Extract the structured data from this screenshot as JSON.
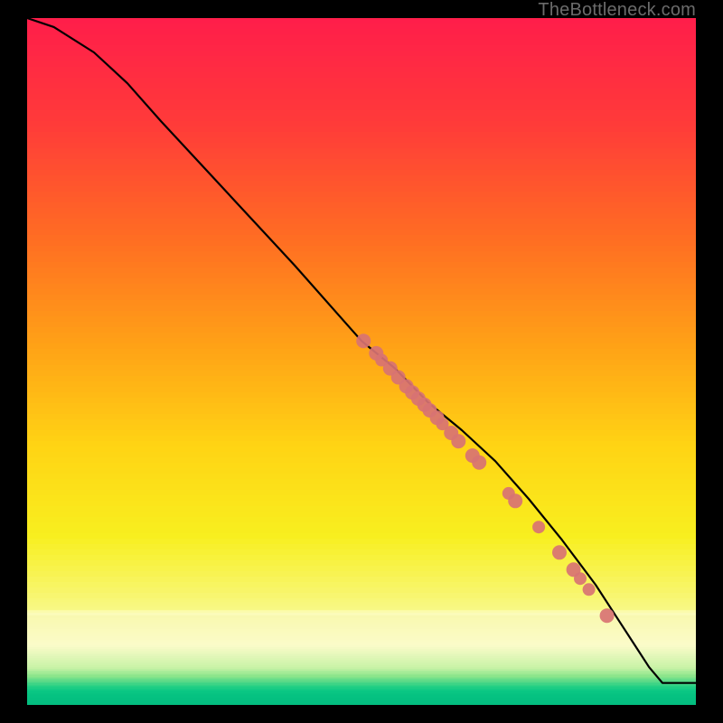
{
  "watermark": "TheBottleneck.com",
  "gradient_plan": {
    "comment": "vertical position (0..1 from top) → color, rendered as stacked horizontal strips",
    "stops": [
      {
        "at": 0.0,
        "color": "#FF1E4A"
      },
      {
        "at": 0.15,
        "color": "#FF3B39"
      },
      {
        "at": 0.32,
        "color": "#FF6E22"
      },
      {
        "at": 0.48,
        "color": "#FFA416"
      },
      {
        "at": 0.62,
        "color": "#FFD414"
      },
      {
        "at": 0.75,
        "color": "#F8EF1F"
      },
      {
        "at": 0.862,
        "color": "#F8F887"
      },
      {
        "at": 0.865,
        "color": "#F8F8AD"
      },
      {
        "at": 0.912,
        "color": "#FBFBC9"
      },
      {
        "at": 0.945,
        "color": "#C7F2A6"
      },
      {
        "at": 0.957,
        "color": "#8BE58B"
      },
      {
        "at": 0.965,
        "color": "#57D988"
      },
      {
        "at": 0.972,
        "color": "#25D084"
      },
      {
        "at": 0.978,
        "color": "#0CC884"
      },
      {
        "at": 0.985,
        "color": "#05C281"
      },
      {
        "at": 1.0,
        "color": "#03BC7F"
      }
    ],
    "narrow_band_effect": true
  },
  "chart_data": {
    "type": "line",
    "title": "",
    "xlabel": "",
    "ylabel": "",
    "xlim": [
      0,
      100
    ],
    "ylim": [
      0,
      100
    ],
    "series": [
      {
        "name": "main-curve",
        "x": [
          0,
          4,
          10,
          15,
          20,
          30,
          40,
          50,
          55,
          60,
          65,
          70,
          75,
          80,
          85,
          88,
          91,
          93,
          95,
          100
        ],
        "y": [
          100,
          98.7,
          95,
          90.5,
          85,
          74.5,
          64,
          53,
          49,
          44,
          40,
          35.5,
          30,
          24,
          17.5,
          13,
          8.5,
          5.5,
          3.2,
          3.2
        ]
      }
    ],
    "scatter": {
      "name": "highlight-points",
      "color": "#D87373",
      "points": [
        {
          "x": 50.3,
          "y": 53.0,
          "r": 8
        },
        {
          "x": 52.2,
          "y": 51.2,
          "r": 8
        },
        {
          "x": 53.0,
          "y": 50.2,
          "r": 7
        },
        {
          "x": 54.3,
          "y": 49.0,
          "r": 8
        },
        {
          "x": 55.5,
          "y": 47.7,
          "r": 8
        },
        {
          "x": 56.7,
          "y": 46.4,
          "r": 8
        },
        {
          "x": 57.6,
          "y": 45.5,
          "r": 8
        },
        {
          "x": 58.5,
          "y": 44.6,
          "r": 8
        },
        {
          "x": 59.4,
          "y": 43.7,
          "r": 8
        },
        {
          "x": 60.2,
          "y": 42.9,
          "r": 8
        },
        {
          "x": 61.3,
          "y": 41.8,
          "r": 8
        },
        {
          "x": 62.1,
          "y": 40.9,
          "r": 7
        },
        {
          "x": 63.4,
          "y": 39.6,
          "r": 8
        },
        {
          "x": 64.5,
          "y": 38.4,
          "r": 8
        },
        {
          "x": 66.6,
          "y": 36.3,
          "r": 8
        },
        {
          "x": 67.6,
          "y": 35.3,
          "r": 8
        },
        {
          "x": 72.0,
          "y": 30.8,
          "r": 7
        },
        {
          "x": 73.0,
          "y": 29.7,
          "r": 8
        },
        {
          "x": 76.5,
          "y": 25.9,
          "r": 7
        },
        {
          "x": 79.6,
          "y": 22.2,
          "r": 8
        },
        {
          "x": 81.7,
          "y": 19.7,
          "r": 8
        },
        {
          "x": 82.7,
          "y": 18.4,
          "r": 7
        },
        {
          "x": 84.0,
          "y": 16.8,
          "r": 7
        },
        {
          "x": 86.7,
          "y": 13.0,
          "r": 8
        }
      ]
    }
  }
}
